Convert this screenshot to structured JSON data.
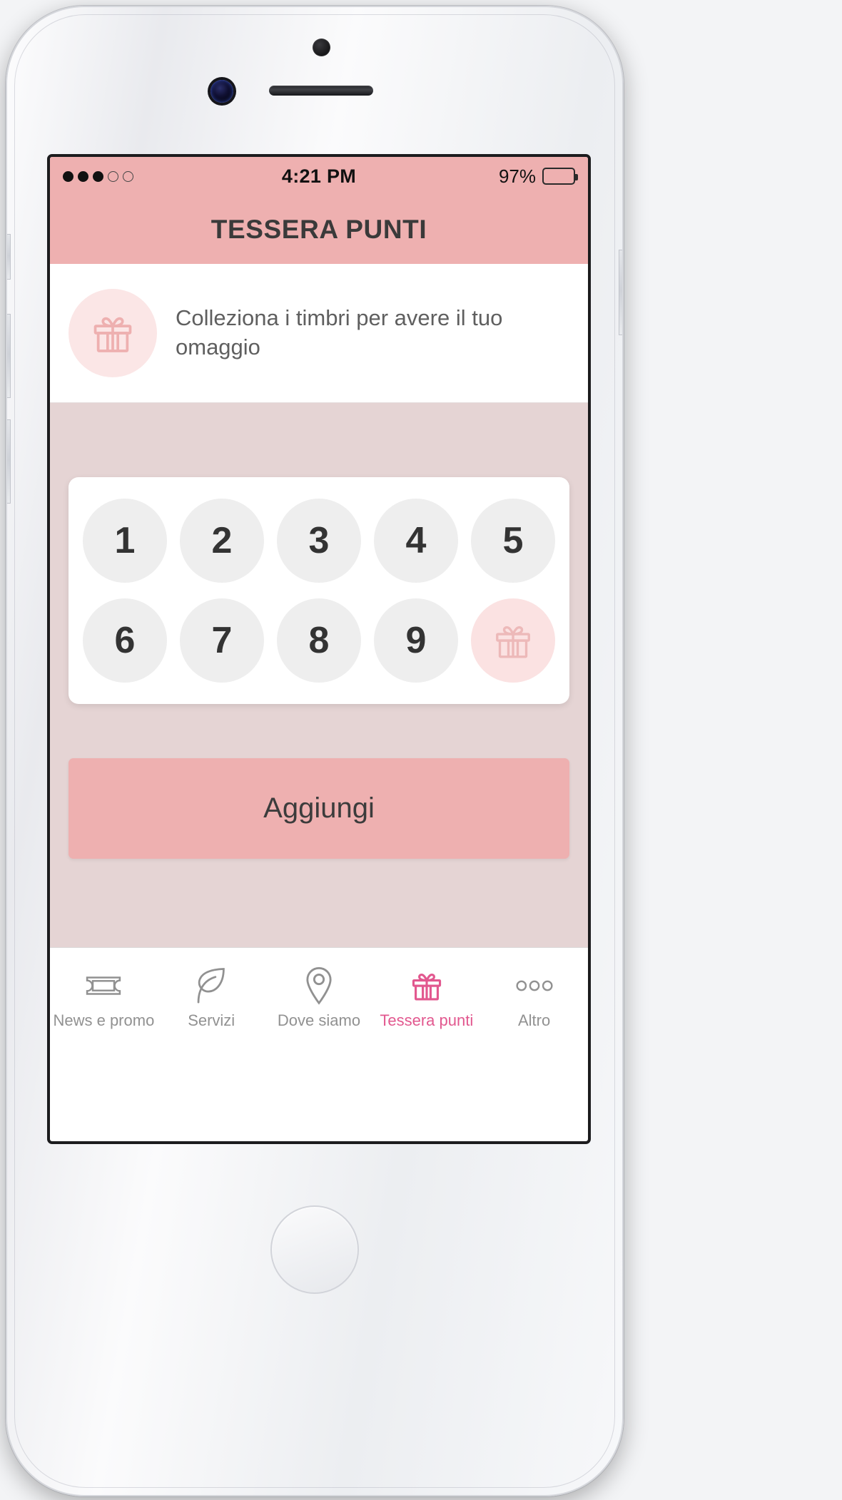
{
  "status_bar": {
    "signal_dots_filled": 3,
    "signal_dots_total": 5,
    "time": "4:21 PM",
    "battery_percent": "97%",
    "battery_level": 97
  },
  "nav_bar": {
    "title": "TESSERA PUNTI"
  },
  "info_banner": {
    "icon": "gift-icon",
    "text": "Colleziona i timbri per avere il tuo omaggio"
  },
  "stamp_card": {
    "rows": [
      [
        {
          "label": "1",
          "type": "number"
        },
        {
          "label": "2",
          "type": "number"
        },
        {
          "label": "3",
          "type": "number"
        },
        {
          "label": "4",
          "type": "number"
        },
        {
          "label": "5",
          "type": "number"
        }
      ],
      [
        {
          "label": "6",
          "type": "number"
        },
        {
          "label": "7",
          "type": "number"
        },
        {
          "label": "8",
          "type": "number"
        },
        {
          "label": "9",
          "type": "number"
        },
        {
          "label": "",
          "type": "reward",
          "icon": "gift-icon"
        }
      ]
    ]
  },
  "actions": {
    "add_label": "Aggiungi"
  },
  "tab_bar": {
    "items": [
      {
        "label": "News e promo",
        "icon": "ticket-icon",
        "active": false
      },
      {
        "label": "Servizi",
        "icon": "leaf-icon",
        "active": false
      },
      {
        "label": "Dove siamo",
        "icon": "map-pin-icon",
        "active": false
      },
      {
        "label": "Tessera punti",
        "icon": "gift-icon",
        "active": true
      },
      {
        "label": "Altro",
        "icon": "more-dots-icon",
        "active": false
      }
    ]
  },
  "colors": {
    "brand_pink": "#eeb0b0",
    "accent_pink": "#e2588f",
    "soft_pink": "#fbe6e6",
    "content_bg": "#e5d4d4",
    "stamp_gray": "#eeeeee",
    "icon_gray": "#919191"
  }
}
